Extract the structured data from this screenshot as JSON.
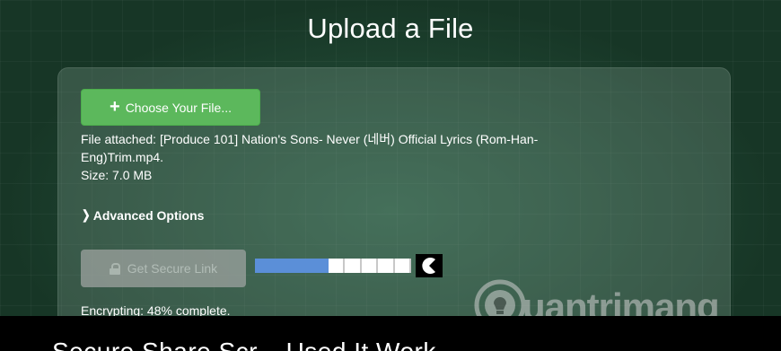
{
  "page": {
    "title": "Upload a File"
  },
  "upload": {
    "choose_label": "Choose Your File...",
    "file_line1": "File attached: [Produce 101] Nation's Sons- Never (네버) Official Lyrics (Rom-Han-",
    "file_line2": "Eng)Trim.mp4.",
    "size_text": "Size: 7.0 MB",
    "advanced_label": "Advanced Options",
    "secure_link_label": "Get Secure Link",
    "status_text": "Encrypting: 48% complete.",
    "progress_fraction": 0.48
  },
  "watermark": {
    "text": "uantrimang"
  },
  "bottom_bar": {
    "text": "Secure Share Scr...      Used It Work..."
  },
  "colors": {
    "choose_button": "#5cb85c",
    "progress_fill": "#5b8fd8",
    "background": "#173626"
  },
  "icons": {
    "choose": "plus-icon",
    "advanced": "chevron-right-icon",
    "secure": "lock-icon",
    "progress_end": "pacman-icon",
    "watermark": "bulb-icon"
  }
}
